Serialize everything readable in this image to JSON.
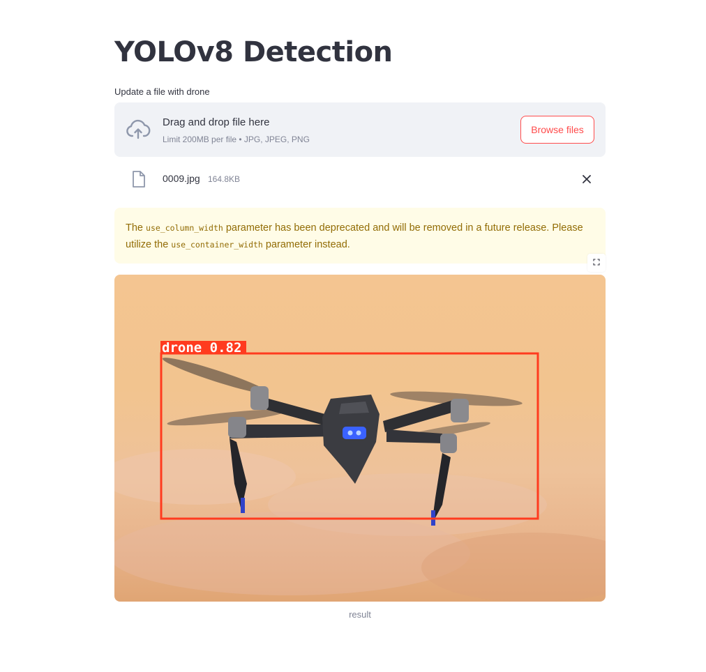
{
  "page": {
    "title": "YOLOv8 Detection"
  },
  "uploader": {
    "label": "Update a file with drone",
    "drop_text": "Drag and drop file here",
    "limit_text": "Limit 200MB per file • JPG, JPEG, PNG",
    "browse_label": "Browse files",
    "upload_icon": "cloud-upload-icon"
  },
  "file": {
    "name": "0009.jpg",
    "size": "164.8KB",
    "icon": "file-icon",
    "remove_icon": "close-icon"
  },
  "warning": {
    "text_1": "The ",
    "code_1": "use_column_width",
    "text_2": " parameter has been deprecated and will be removed in a future release. Please utilize the ",
    "code_2": "use_container_width",
    "text_3": " parameter instead."
  },
  "result_image": {
    "detection_label": "drone 0.82",
    "caption": "result",
    "box_color": "#ff3b1f",
    "fullscreen_icon": "fullscreen-icon"
  },
  "colors": {
    "accent": "#ff4b4b",
    "text": "#31333f",
    "muted": "#808495",
    "dropzone_bg": "#f0f2f6",
    "warning_bg": "#fffce7",
    "warning_text": "#926c05"
  }
}
